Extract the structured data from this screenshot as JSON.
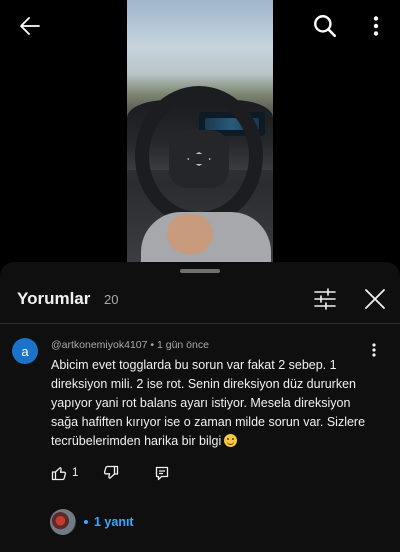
{
  "video": {
    "icons": {
      "back": "arrow-left-icon",
      "search": "search-icon",
      "more": "more-vert-icon"
    }
  },
  "comments_panel": {
    "title": "Yorumlar",
    "count": "20",
    "icons": {
      "filter": "tune-icon",
      "close": "close-icon"
    }
  },
  "comment": {
    "avatar_letter": "a",
    "avatar_color": "#1a73c9",
    "meta": "@artkonemiyok4107 • 1 gün önce",
    "text": "Abicim evet togglarda bu sorun var fakat 2 sebep. 1 direksiyon mili. 2 ise rot. Senin direksiyon düz dururken yapıyor yani rot balans ayarı istiyor. Mesela direksiyon sağa hafiften kırıyor ise o zaman milde sorun var. Sizlere tecrübelerimden harika bir bilgi",
    "emoji": "grinning-face",
    "like_count": "1",
    "replies_label": "1 yanıt",
    "replies_color": "#3ea6ff"
  }
}
